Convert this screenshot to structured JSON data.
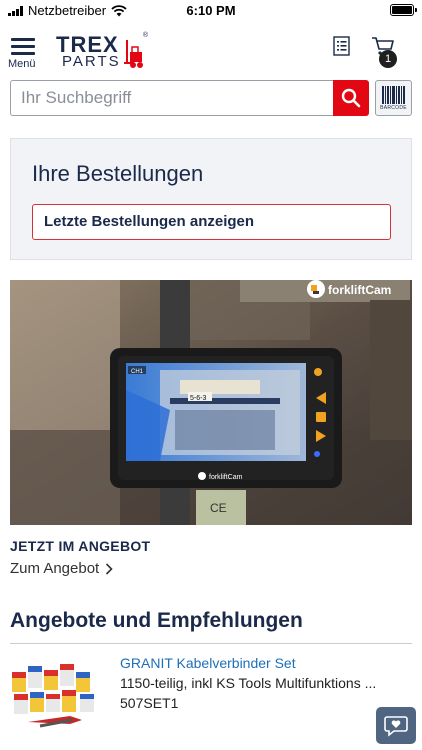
{
  "status_bar": {
    "carrier": "Netzbetreiber",
    "time": "6:10 PM",
    "wifi_icon": "wifi-icon",
    "battery_icon": "battery-icon"
  },
  "header": {
    "menu_label": "Menü",
    "logo_trex": "TREX",
    "logo_parts": "PARTS",
    "logo_reg": "®",
    "orders_icon": "order-list-icon",
    "cart_icon": "cart-icon",
    "cart_count": "1"
  },
  "search": {
    "placeholder": "Ihr Suchbegriff",
    "value": "",
    "search_icon": "search-icon",
    "barcode_icon": "barcode-icon",
    "barcode_label": "BARCODE"
  },
  "orders": {
    "title": "Ihre Bestellungen",
    "button_label": "Letzte Bestellungen anzeigen"
  },
  "banner": {
    "brand": "forkliftCam",
    "device_brand": "forkliftCam",
    "screen_label": "CH1",
    "shelf_label": "5-6-3",
    "device_mark": "CE",
    "tag": "JETZT IM ANGEBOT",
    "link": "Zum Angebot"
  },
  "recommendations": {
    "title": "Angebote und Empfehlungen",
    "items": [
      {
        "name": "GRANIT Kabelverbinder Set",
        "description": "1150-teilig, inkl KS Tools Multifunktions ...",
        "sku": "507SET1"
      }
    ]
  },
  "chat": {
    "icon": "chat-heart-icon"
  },
  "colors": {
    "brand_navy": "#1b2a4a",
    "accent_red": "#e30613",
    "link_blue": "#1f6fb8"
  }
}
